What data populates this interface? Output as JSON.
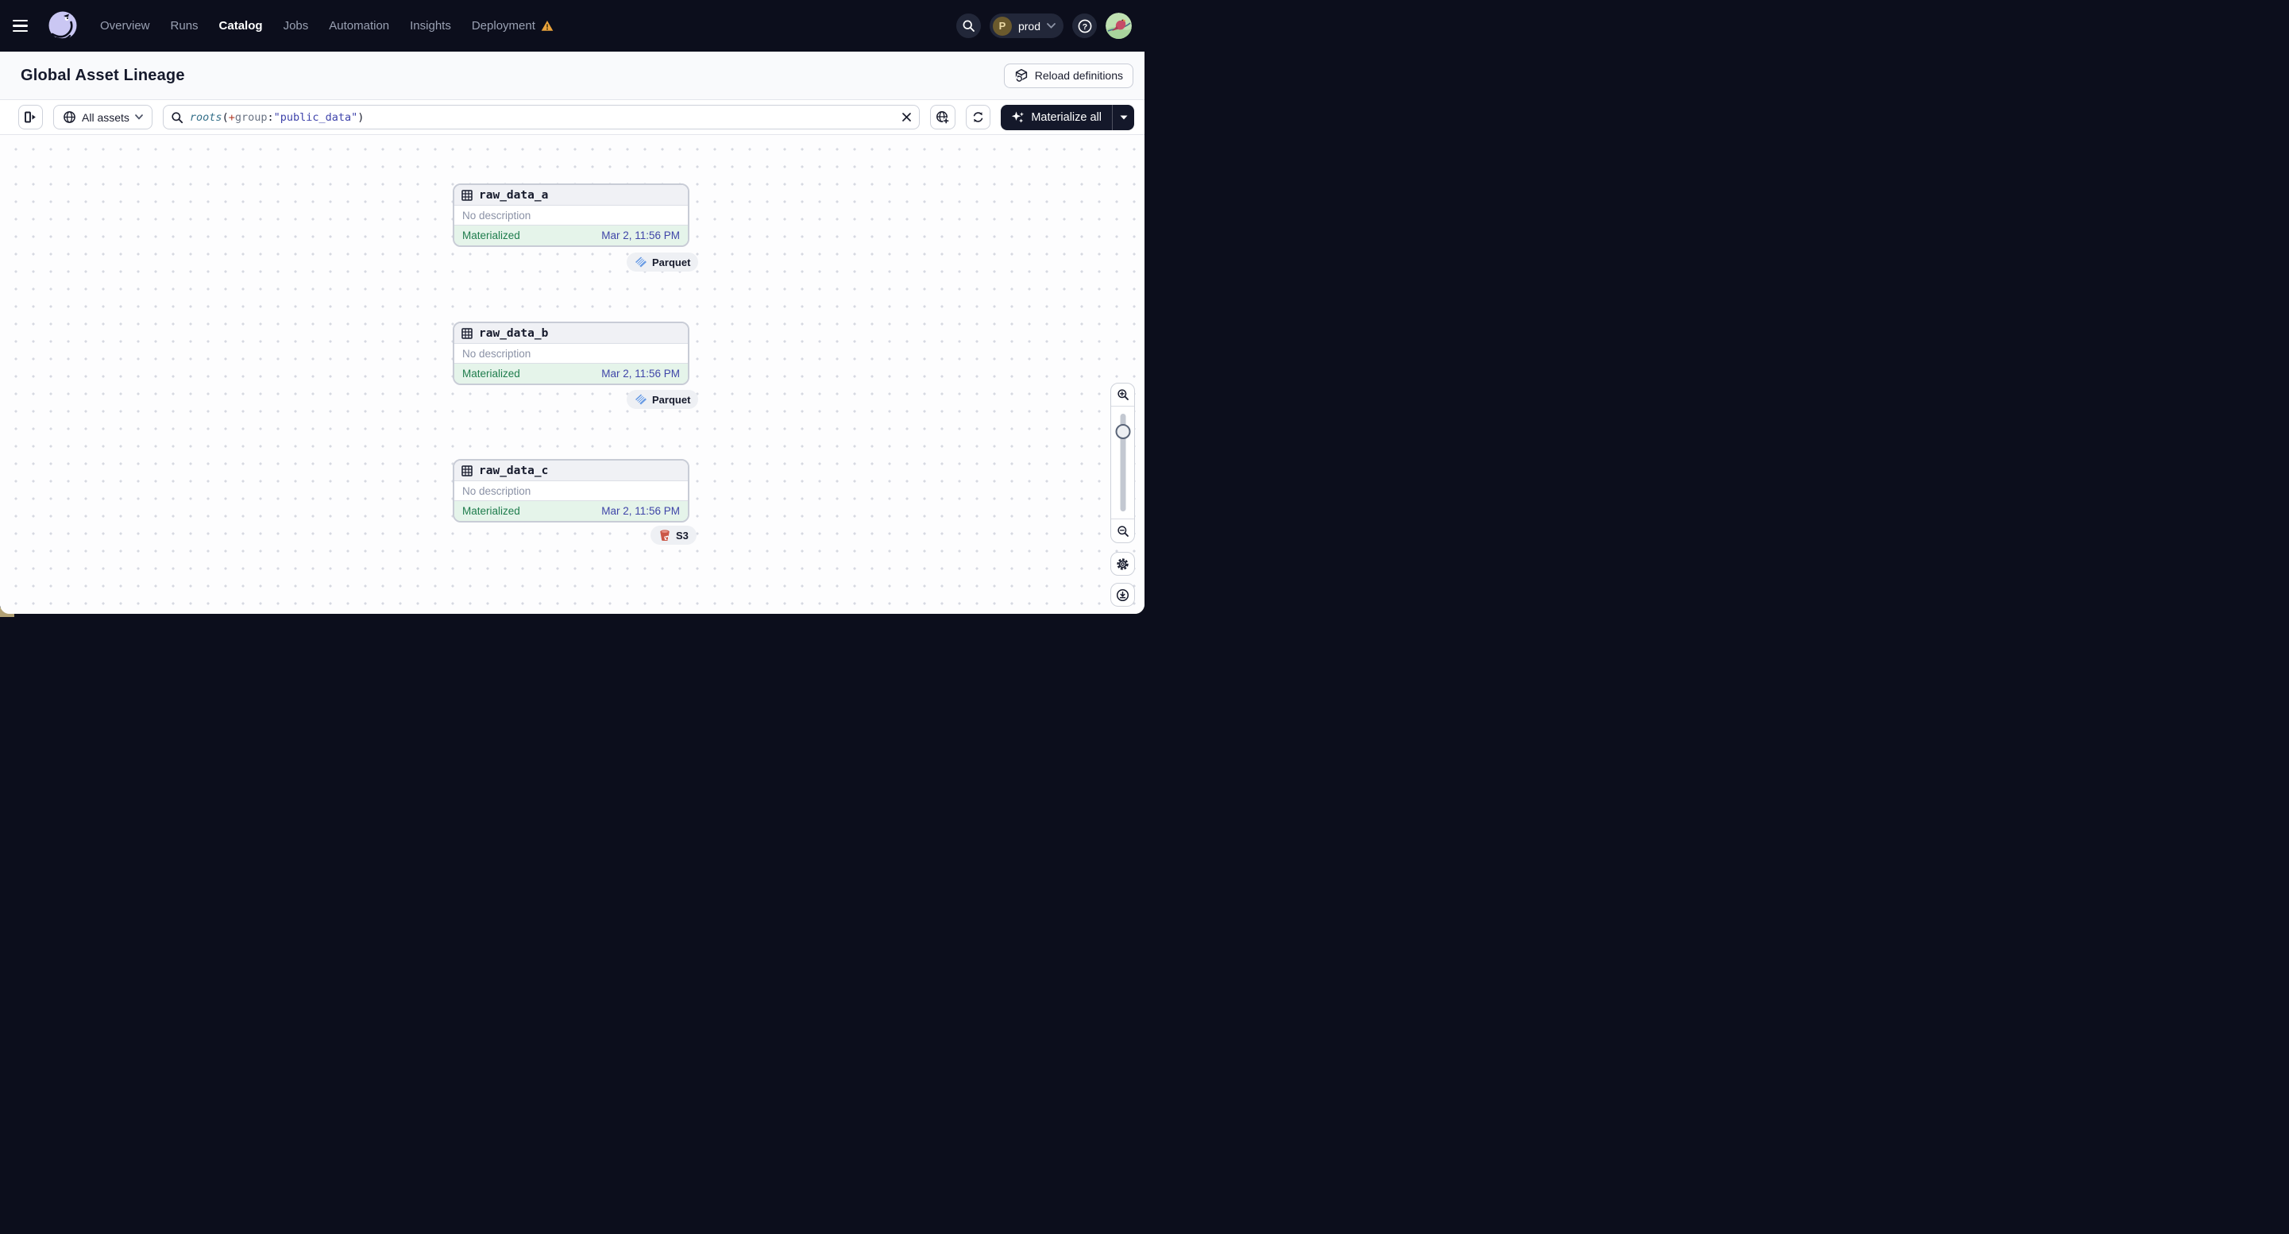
{
  "navbar": {
    "items": [
      {
        "label": "Overview"
      },
      {
        "label": "Runs"
      },
      {
        "label": "Catalog"
      },
      {
        "label": "Jobs"
      },
      {
        "label": "Automation"
      },
      {
        "label": "Insights"
      },
      {
        "label": "Deployment"
      }
    ],
    "active_item": "Catalog",
    "env": {
      "initial": "P",
      "name": "prod"
    }
  },
  "page": {
    "title": "Global Asset Lineage",
    "reload_button": "Reload definitions"
  },
  "toolbar": {
    "filter_label": "All assets",
    "materialize_label": "Materialize all",
    "query": {
      "func": "roots",
      "open_paren": "(",
      "plus": "+",
      "key": "group",
      "colon": ":",
      "value": "\"public_data\"",
      "close_paren": ")"
    }
  },
  "graph": {
    "nodes": [
      {
        "name": "raw_data_a",
        "description": "No description",
        "status": "Materialized",
        "materialized_at": "Mar 2, 11:56 PM",
        "tag": {
          "label": "Parquet",
          "icon": "parquet-icon"
        }
      },
      {
        "name": "raw_data_b",
        "description": "No description",
        "status": "Materialized",
        "materialized_at": "Mar 2, 11:56 PM",
        "tag": {
          "label": "Parquet",
          "icon": "parquet-icon"
        }
      },
      {
        "name": "raw_data_c",
        "description": "No description",
        "status": "Materialized",
        "materialized_at": "Mar 2, 11:56 PM",
        "tag": {
          "label": "S3",
          "icon": "s3-icon"
        }
      }
    ]
  },
  "colors": {
    "navbar_bg": "#0c0e1c",
    "warning_orange": "#e9a23b",
    "materialized_green": "#1e7c4c",
    "materialized_bg": "#e5f4ea",
    "timestamp_indigo": "#3f45a8",
    "query_func_teal": "#35708a",
    "query_plus_red": "#b23c28",
    "query_string_indigo": "#3f44ab",
    "parquet_blue": "#6b9ce3",
    "s3_red": "#cb5746",
    "env_badge_olive": "#6b5a2d"
  }
}
